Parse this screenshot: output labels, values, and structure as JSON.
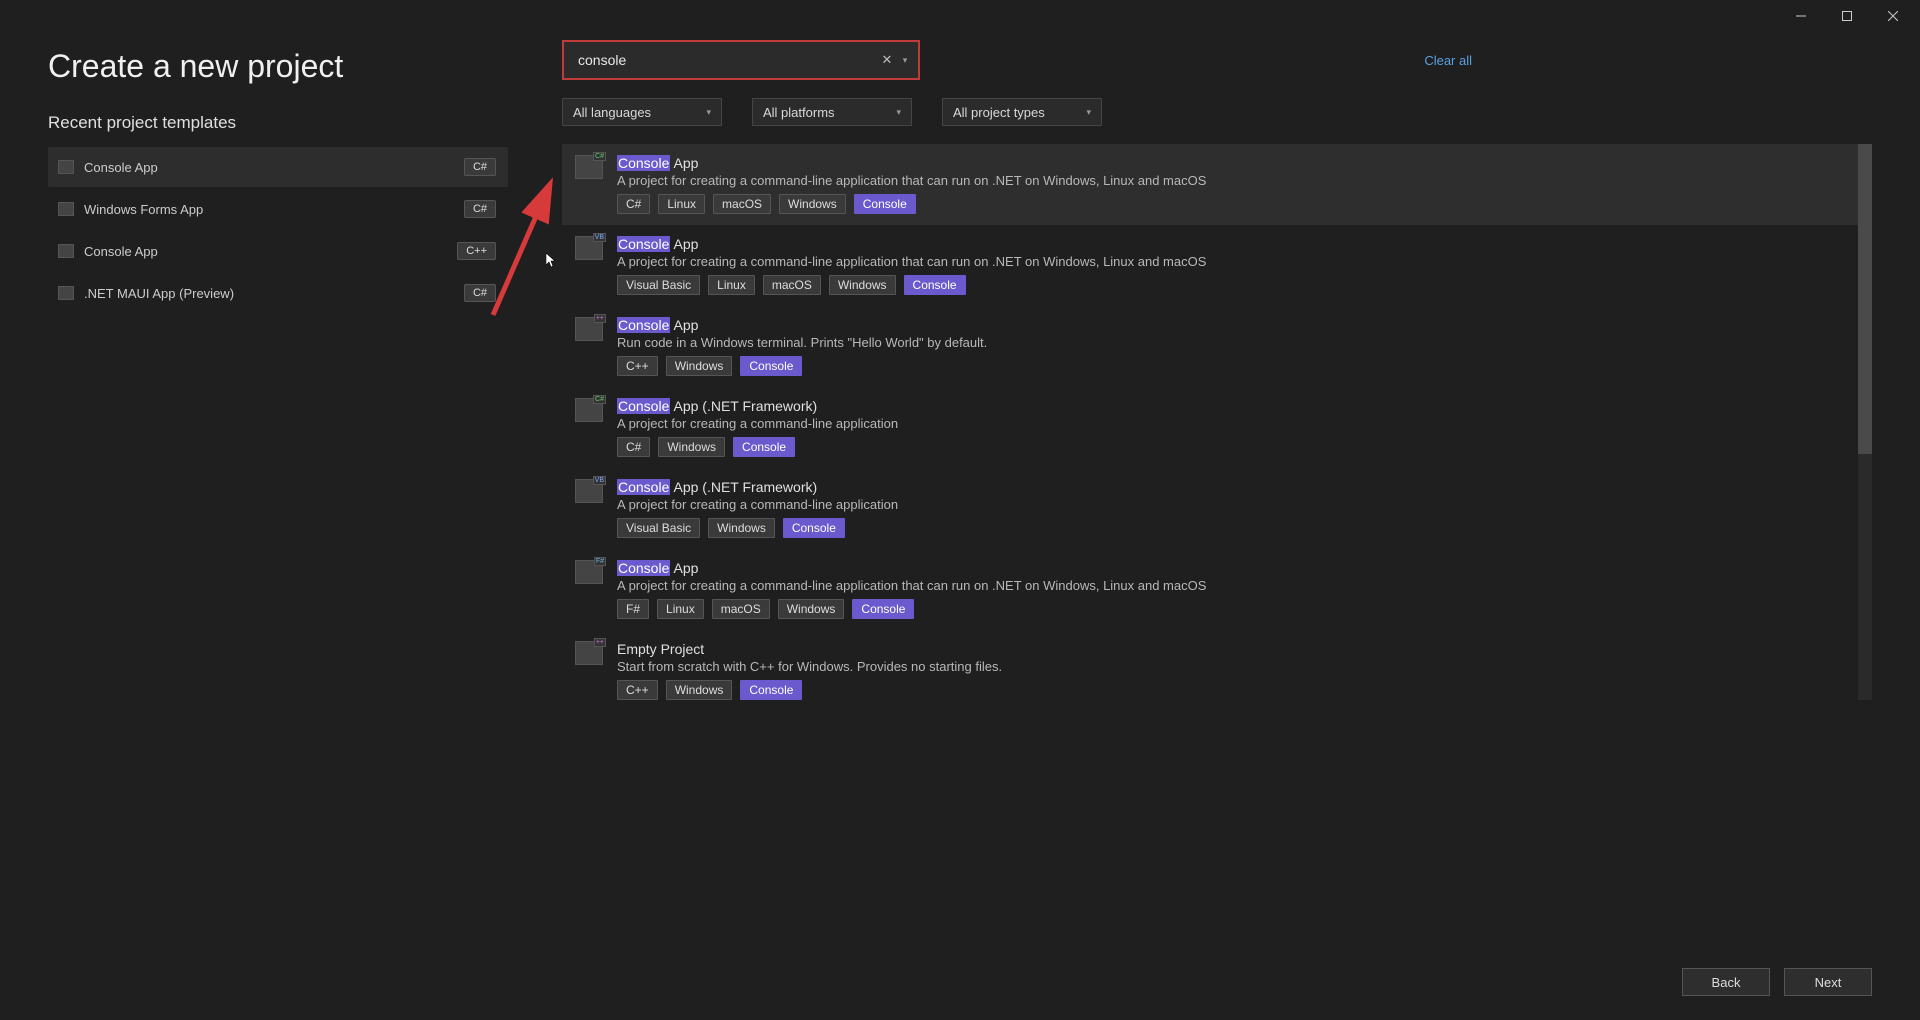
{
  "window": {
    "title": "Create a new project"
  },
  "page": {
    "heading": "Create a new project",
    "recent_heading": "Recent project templates"
  },
  "recent": [
    {
      "name": "Console App",
      "lang": "C#",
      "selected": true
    },
    {
      "name": "Windows Forms App",
      "lang": "C#",
      "selected": false
    },
    {
      "name": "Console App",
      "lang": "C++",
      "selected": false
    },
    {
      "name": ".NET MAUI App (Preview)",
      "lang": "C#",
      "selected": false
    }
  ],
  "search": {
    "value": "console",
    "highlight": "Console"
  },
  "clear_all": "Clear all",
  "filters": {
    "languages": "All languages",
    "platforms": "All platforms",
    "types": "All project types"
  },
  "results": [
    {
      "lang_mark": "C#",
      "icon_class": "cs",
      "selected": true,
      "title_suffix": " App",
      "desc": "A project for creating a command-line application that can run on .NET on Windows, Linux and macOS",
      "tags": [
        "C#",
        "Linux",
        "macOS",
        "Windows"
      ],
      "tag_hl": "Console"
    },
    {
      "lang_mark": "VB",
      "icon_class": "vb",
      "selected": false,
      "title_suffix": " App",
      "desc": "A project for creating a command-line application that can run on .NET on Windows, Linux and macOS",
      "tags": [
        "Visual Basic",
        "Linux",
        "macOS",
        "Windows"
      ],
      "tag_hl": "Console"
    },
    {
      "lang_mark": "++",
      "icon_class": "cpp",
      "selected": false,
      "title_suffix": " App",
      "desc": "Run code in a Windows terminal. Prints \"Hello World\" by default.",
      "tags": [
        "C++",
        "Windows"
      ],
      "tag_hl": "Console"
    },
    {
      "lang_mark": "C#",
      "icon_class": "cs",
      "selected": false,
      "title_suffix": " App (.NET Framework)",
      "desc": "A project for creating a command-line application",
      "tags": [
        "C#",
        "Windows"
      ],
      "tag_hl": "Console"
    },
    {
      "lang_mark": "VB",
      "icon_class": "vb",
      "selected": false,
      "title_suffix": " App (.NET Framework)",
      "desc": "A project for creating a command-line application",
      "tags": [
        "Visual Basic",
        "Windows"
      ],
      "tag_hl": "Console"
    },
    {
      "lang_mark": "F#",
      "icon_class": "fs",
      "selected": false,
      "title_suffix": " App",
      "desc": "A project for creating a command-line application that can run on .NET on Windows, Linux and macOS",
      "tags": [
        "F#",
        "Linux",
        "macOS",
        "Windows"
      ],
      "tag_hl": "Console"
    },
    {
      "lang_mark": "++",
      "icon_class": "cpp",
      "selected": false,
      "title_plain": "Empty Project",
      "desc": "Start from scratch with C++ for Windows. Provides no starting files.",
      "tags": [
        "C++",
        "Windows"
      ],
      "tag_hl": "Console"
    }
  ],
  "footer": {
    "back": "Back",
    "next": "Next"
  }
}
